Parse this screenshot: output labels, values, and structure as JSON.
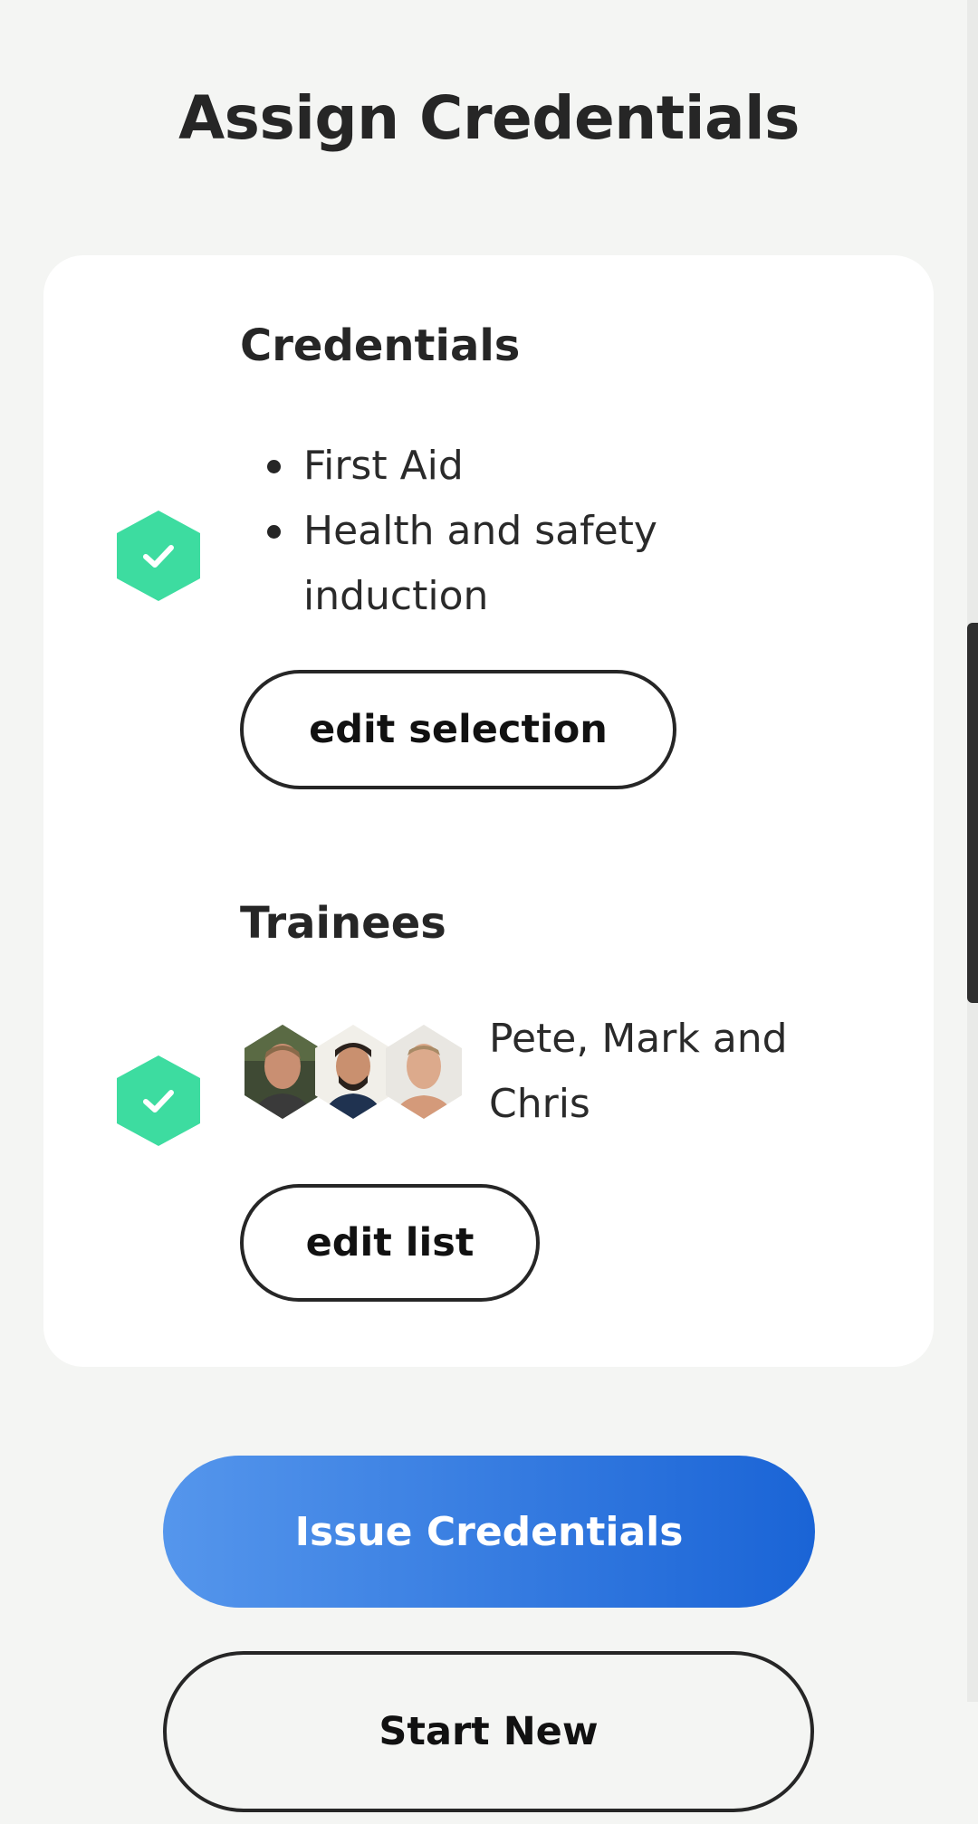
{
  "header": {
    "title": "Assign Credentials"
  },
  "credentials_section": {
    "heading": "Credentials",
    "status_icon": "check-hexagon-icon",
    "items": [
      {
        "label": "First Aid"
      },
      {
        "label": "Health and safety induction"
      }
    ],
    "edit_button_label": "edit selection"
  },
  "trainees_section": {
    "heading": "Trainees",
    "status_icon": "check-hexagon-icon",
    "avatars": [
      "Pete",
      "Mark",
      "Chris"
    ],
    "names_text": "Pete, Mark and Chris",
    "edit_button_label": "edit list"
  },
  "actions": {
    "primary_label": "Issue Credentials",
    "secondary_label": "Start New"
  },
  "colors": {
    "background": "#f4f5f3",
    "card": "#ffffff",
    "check_green": "#3ddca0",
    "primary_gradient_start": "#5596ec",
    "primary_gradient_end": "#1a64d6",
    "text": "#262626"
  }
}
